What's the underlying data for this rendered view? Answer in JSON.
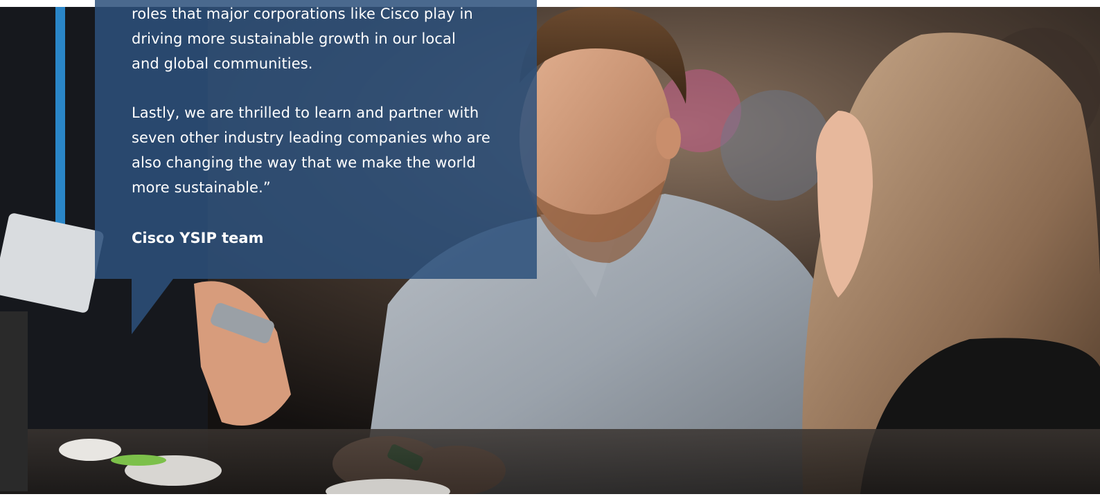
{
  "quote": {
    "paragraph1_lines": [
      "roles that major corporations like Cisco play in",
      "driving more sustainable growth in our local",
      "and global communities."
    ],
    "paragraph2_lines": [
      "Lastly, we are thrilled to learn and partner with",
      "seven other industry leading companies who are",
      "also changing the way that we make the world",
      "more sustainable.”"
    ],
    "author": "Cisco YSIP team"
  },
  "colors": {
    "panel": "#2c507c",
    "text": "#ffffff"
  }
}
